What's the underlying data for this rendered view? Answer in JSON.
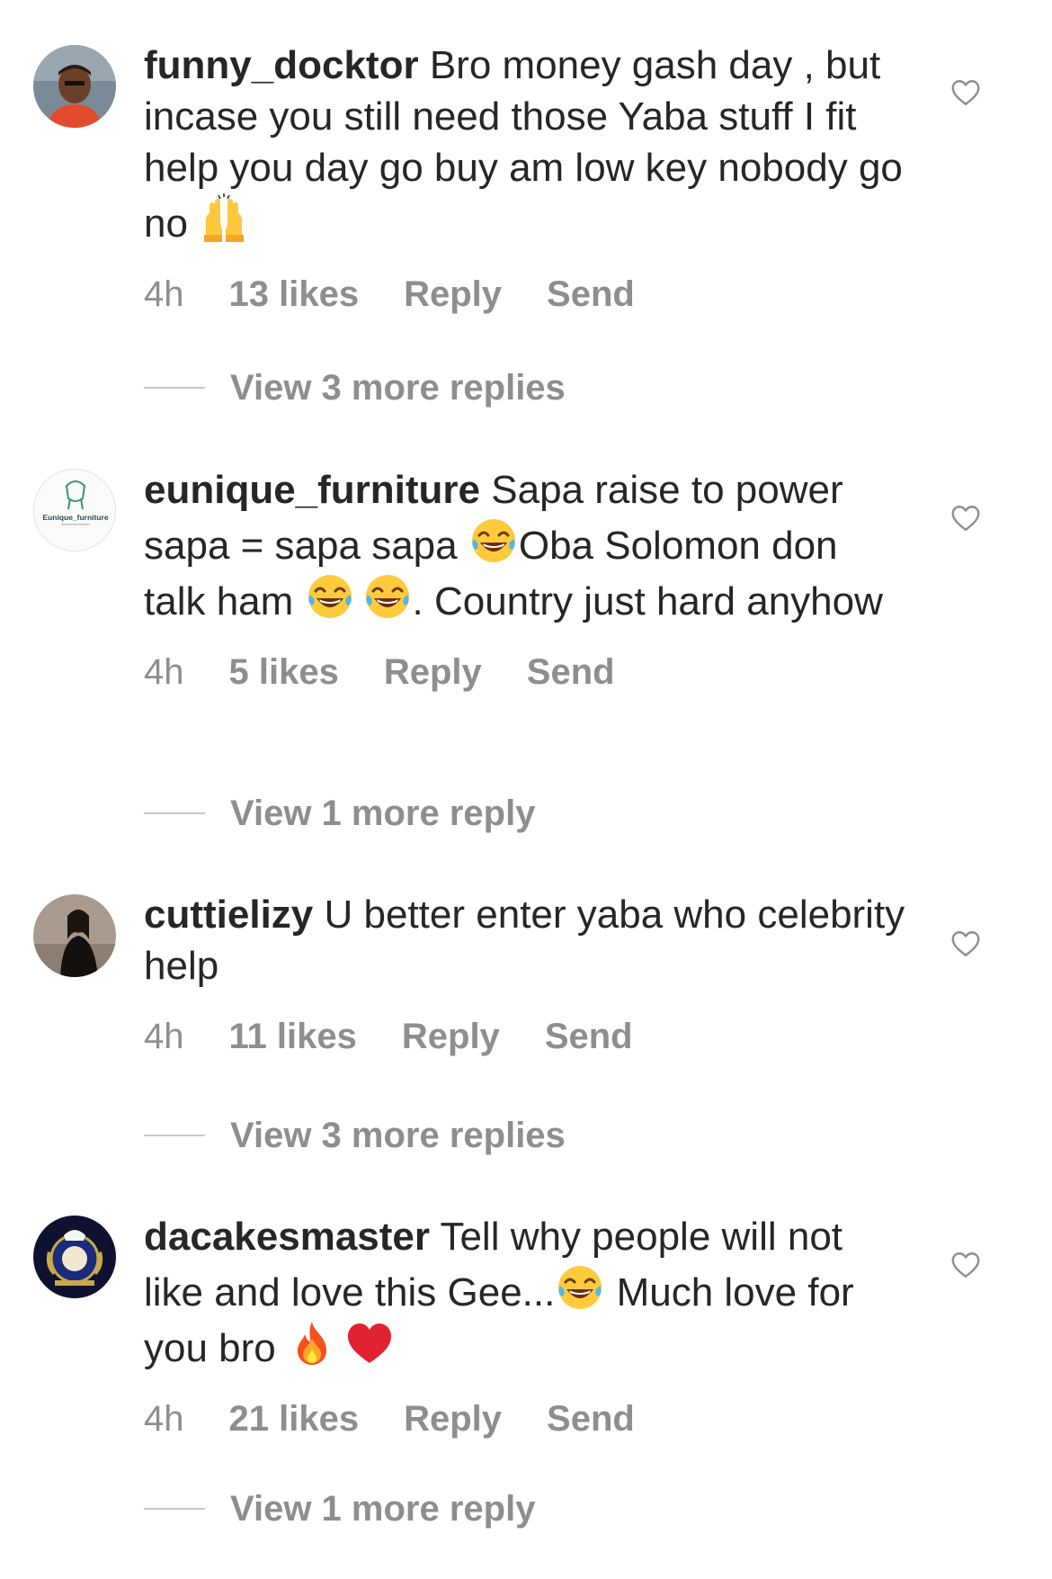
{
  "comments": [
    {
      "username": "funny_docktor",
      "text_parts": [
        "Bro money gash day , but incase you still need those Yaba stuff I fit help you day go buy am low key nobody go no "
      ],
      "emojis": [
        "raising-hands"
      ],
      "time": "4h",
      "likes": "13 likes",
      "reply": "Reply",
      "send": "Send",
      "view_more": "View 3 more replies"
    },
    {
      "username": "eunique_furniture",
      "avatar_text": "Eunique_furniture",
      "text_a": "Sapa raise to power sapa = sapa sapa ",
      "text_b": "Oba Solomon don talk ham ",
      "text_c": ". Country just hard anyhow",
      "time": "4h",
      "likes": "5 likes",
      "reply": "Reply",
      "send": "Send",
      "view_more": "View 1 more reply"
    },
    {
      "username": "cuttielizy",
      "text": "U better enter yaba who celebrity help",
      "time": "4h",
      "likes": "11 likes",
      "reply": "Reply",
      "send": "Send",
      "view_more": "View 3 more replies"
    },
    {
      "username": "dacakesmaster",
      "text_a": "Tell why people will not like and love this Gee...",
      "text_b": " Much love for you bro ",
      "time": "4h",
      "likes": "21 likes",
      "reply": "Reply",
      "send": "Send",
      "view_more": "View 1 more reply"
    }
  ],
  "icons": {
    "heart": "heart-outline-icon",
    "laughing": "face-with-tears-of-joy-emoji",
    "raising_hands": "raising-hands-emoji",
    "fire": "fire-emoji",
    "red_heart": "red-heart-emoji"
  },
  "colors": {
    "text": "#262626",
    "secondary": "#8e8e8e",
    "divider": "#c7c7c7"
  }
}
